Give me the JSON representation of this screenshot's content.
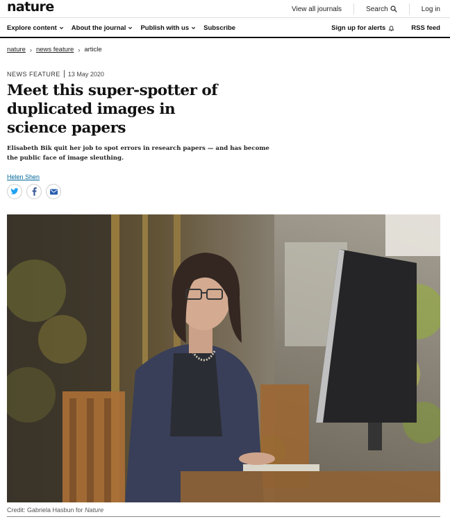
{
  "header": {
    "logo": "nature",
    "links": {
      "journals": "View all journals",
      "search": "Search",
      "login": "Log in"
    }
  },
  "nav": {
    "explore": "Explore content",
    "about": "About the journal",
    "publish": "Publish with us",
    "subscribe": "Subscribe",
    "alerts": "Sign up for alerts",
    "rss": "RSS feed"
  },
  "breadcrumb": {
    "home": "nature",
    "section": "news feature",
    "current": "article"
  },
  "article": {
    "type": "NEWS FEATURE",
    "date": "13 May 2020",
    "title": "Meet this super-spotter of duplicated images in science papers",
    "standfirst": "Elisabeth Bik quit her job to spot errors in research papers — and has become the public face of image sleuthing.",
    "author": "Helen Shen",
    "image_alt": "Elisabeth Bik at her desk",
    "caption_prefix": "Credit: Gabriela Hasbun for ",
    "caption_italic": "Nature"
  },
  "icons": {
    "twitter": "twitter-icon",
    "facebook": "facebook-icon",
    "email": "email-icon",
    "search": "search-icon",
    "bell": "bell-icon"
  },
  "colors": {
    "link": "#006699",
    "twitter": "#1da1f2",
    "facebook": "#3b5998",
    "email": "#2a5db0"
  }
}
